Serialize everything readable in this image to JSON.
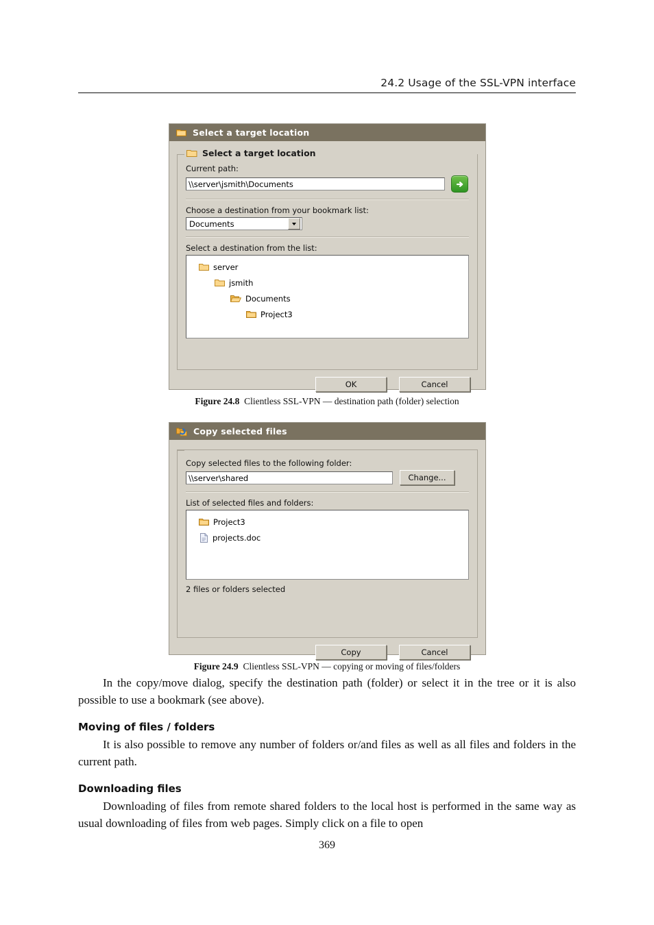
{
  "page": {
    "running_header": "24.2  Usage of the SSL-VPN interface",
    "folio": "369"
  },
  "dialog_target": {
    "titlebar": {
      "icon": "folder-icon",
      "title": "Select a target location"
    },
    "group": {
      "icon": "folder-icon",
      "legend": "Select a target location"
    },
    "current_path": {
      "label": "Current path:",
      "value": "\\\\server\\jsmith\\Documents",
      "go_icon": "arrow-right-go-icon"
    },
    "bookmark": {
      "label": "Choose a destination from your bookmark list:",
      "selected": "Documents",
      "arrow_icon": "chevron-down-icon"
    },
    "destination_list": {
      "label": "Select a destination from the list:",
      "items": [
        {
          "name": "server",
          "depth": 0,
          "icon": "folder-icon"
        },
        {
          "name": "jsmith",
          "depth": 1,
          "icon": "folder-icon"
        },
        {
          "name": "Documents",
          "depth": 2,
          "icon": "folder-open-icon"
        },
        {
          "name": "Project3",
          "depth": 3,
          "icon": "folder-icon"
        }
      ]
    },
    "buttons": {
      "ok": "OK",
      "cancel": "Cancel"
    }
  },
  "caption_1": {
    "label": "Figure 24.8",
    "text": "Clientless SSL-VPN — destination path (folder) selection"
  },
  "dialog_copy": {
    "titlebar": {
      "icon": "copy-files-icon",
      "title": "Copy selected files"
    },
    "destination": {
      "label": "Copy selected files to the following folder:",
      "value": "\\\\server\\shared",
      "change_button": "Change..."
    },
    "selection_list": {
      "label": "List of selected files and folders:",
      "items": [
        {
          "name": "Project3",
          "icon": "folder-icon"
        },
        {
          "name": "projects.doc",
          "icon": "document-icon"
        }
      ],
      "status": "2 files or folders selected"
    },
    "buttons": {
      "copy": "Copy",
      "cancel": "Cancel"
    }
  },
  "caption_2": {
    "label": "Figure 24.9",
    "text": "Clientless SSL-VPN — copying or moving of files/folders"
  },
  "content": {
    "para_intro": "In the copy/move dialog, specify the destination path (folder) or select it in the tree or it is also possible to use a bookmark (see above).",
    "heading_moving": "Moving of files / folders",
    "para_moving": "It is also possible to remove any number of folders or/and files as well as all files and folders in the current path.",
    "heading_downloading": "Downloading files",
    "para_downloading": "Downloading of files from remote shared folders to the local host is performed in the same way as usual downloading of files from web pages.  Simply click on a file to open"
  },
  "colors": {
    "titlebar": "#7a7260",
    "dialog_face": "#d6d2c8",
    "folder_gold": "#f0b74a",
    "go_green": "#3aa32a"
  }
}
